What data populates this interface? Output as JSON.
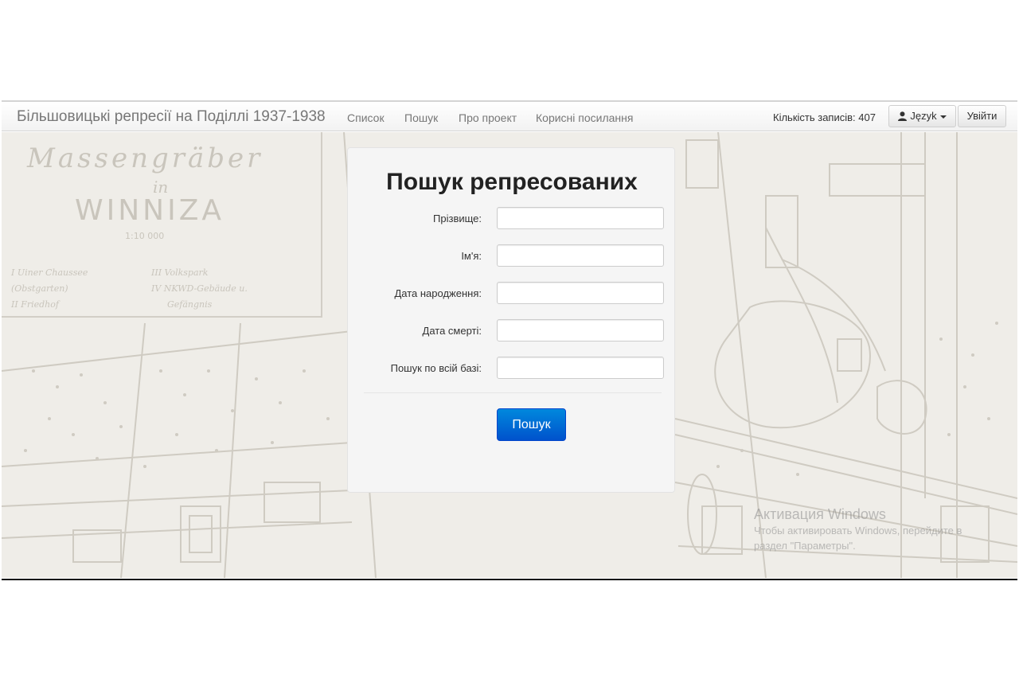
{
  "navbar": {
    "brand": "Більшовицькі репресії на Поділлі 1937-1938",
    "links": [
      "Список",
      "Пошук",
      "Про проект",
      "Корисні посилання"
    ],
    "record_count": "Кількість записів: 407",
    "language_label": "Język",
    "login_label": "Увійти"
  },
  "map": {
    "title_line1": "Massengräber",
    "title_line2": "in",
    "title_line3": "WINNIZA",
    "scale": "1:10 000",
    "legend": [
      "I Uiner Chaussee",
      "(Obstgarten)",
      "II Friedhof",
      "III Volkspark",
      "IV NKWD-Gebäude u.",
      "Gefängnis"
    ]
  },
  "search": {
    "title": "Пошук репресованих",
    "fields": [
      {
        "label": "Прізвище:",
        "value": ""
      },
      {
        "label": "Ім'я:",
        "value": ""
      },
      {
        "label": "Дата народження:",
        "value": ""
      },
      {
        "label": "Дата смерті:",
        "value": ""
      },
      {
        "label": "Пошук по всій базі:",
        "value": ""
      }
    ],
    "submit_label": "Пошук"
  },
  "watermark": {
    "title": "Активация Windows",
    "text": "Чтобы активировать Windows, перейдите в раздел \"Параметры\"."
  },
  "colors": {
    "primary_button": "#0066cc",
    "panel_bg": "#f5f5f5",
    "map_bg": "#efede8"
  }
}
